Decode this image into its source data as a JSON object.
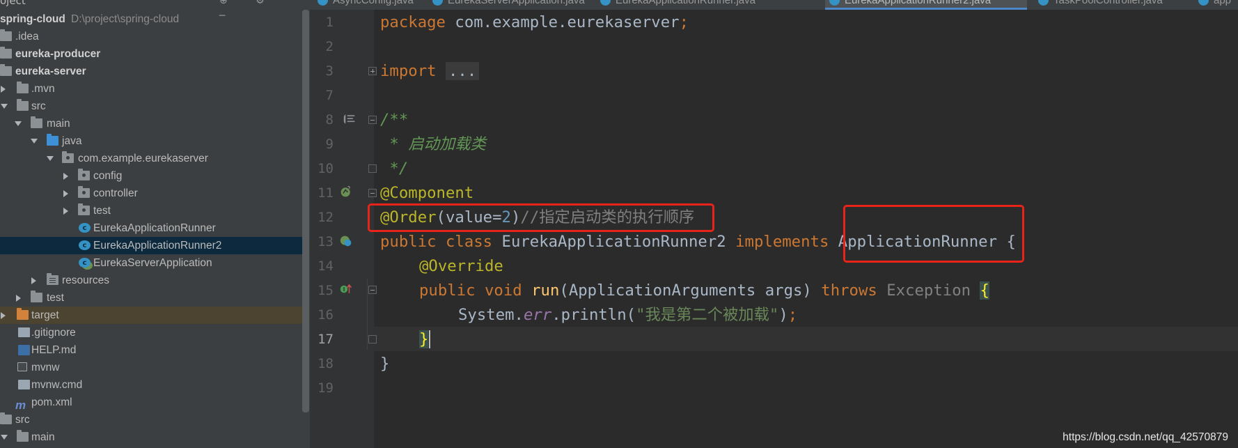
{
  "tree": {
    "header_label": "oject",
    "rows": [
      {
        "label": "spring-cloud",
        "path": "D:\\project\\spring-cloud",
        "bold": true
      },
      {
        "label": ".idea"
      },
      {
        "label": "eureka-producer",
        "bold": true
      },
      {
        "label": "eureka-server",
        "bold": true
      },
      {
        "label": ".mvn"
      },
      {
        "label": "src"
      },
      {
        "label": "main"
      },
      {
        "label": "java"
      },
      {
        "label": "com.example.eurekaserver"
      },
      {
        "label": "config"
      },
      {
        "label": "controller"
      },
      {
        "label": "test"
      },
      {
        "label": "EurekaApplicationRunner"
      },
      {
        "label": "EurekaApplicationRunner2"
      },
      {
        "label": "EurekaServerApplication"
      },
      {
        "label": "resources"
      },
      {
        "label": "test"
      },
      {
        "label": "target"
      },
      {
        "label": ".gitignore"
      },
      {
        "label": "HELP.md"
      },
      {
        "label": "mvnw"
      },
      {
        "label": "mvnw.cmd"
      },
      {
        "label": "pom.xml"
      },
      {
        "label": "src"
      },
      {
        "label": "main"
      }
    ]
  },
  "tabs": [
    {
      "label": "AsyncConfig.java"
    },
    {
      "label": "EurekaServerApplication.java"
    },
    {
      "label": "EurekaApplicationRunner.java"
    },
    {
      "label": "EurekaApplicationRunner2.java",
      "active": true
    },
    {
      "label": "TaskPoolController.java"
    },
    {
      "label": "app"
    }
  ],
  "editor": {
    "line_numbers": [
      "1",
      "2",
      "3",
      "7",
      "8",
      "9",
      "10",
      "11",
      "12",
      "13",
      "14",
      "15",
      "16",
      "17",
      "18",
      "19"
    ],
    "lines": {
      "l1_kw": "package",
      "l1_rest": " com.example.eurekaserver",
      "l1_semi": ";",
      "l3_kw": "import",
      "l3_dots": "...",
      "l8": "/**",
      "l9": " * 启动加载类",
      "l10": " */",
      "l11": "@Component",
      "l12_ann": "@Order",
      "l12_open": "(value=",
      "l12_num": "2",
      "l12_close": ")",
      "l12_cmt": "//指定启动类的执行顺序",
      "l13_kw1": "public class",
      "l13_name": " EurekaApplicationRunner2 ",
      "l13_kw2": "implements",
      "l13_iface": " ApplicationRunner ",
      "l13_brace": "{",
      "l14": "@Override",
      "l15_kw": "public void",
      "l15_fn": "run",
      "l15_args": "(ApplicationArguments args) ",
      "l15_throws": "throws",
      "l15_exc": " Exception ",
      "l15_brace": "{",
      "l16_a": "System.",
      "l16_fld": "err",
      "l16_b": ".println(",
      "l16_str": "\"我是第二个被加载\"",
      "l16_c": ")",
      "l16_semi": ";",
      "l17": "}",
      "l18": "}"
    }
  },
  "watermark": "https://blog.csdn.net/qq_42570879",
  "colors": {
    "highlight_box": "#e8241a",
    "keyword": "#cc7832",
    "annotation": "#bbb529",
    "string": "#6a8759",
    "number": "#6897bb"
  }
}
